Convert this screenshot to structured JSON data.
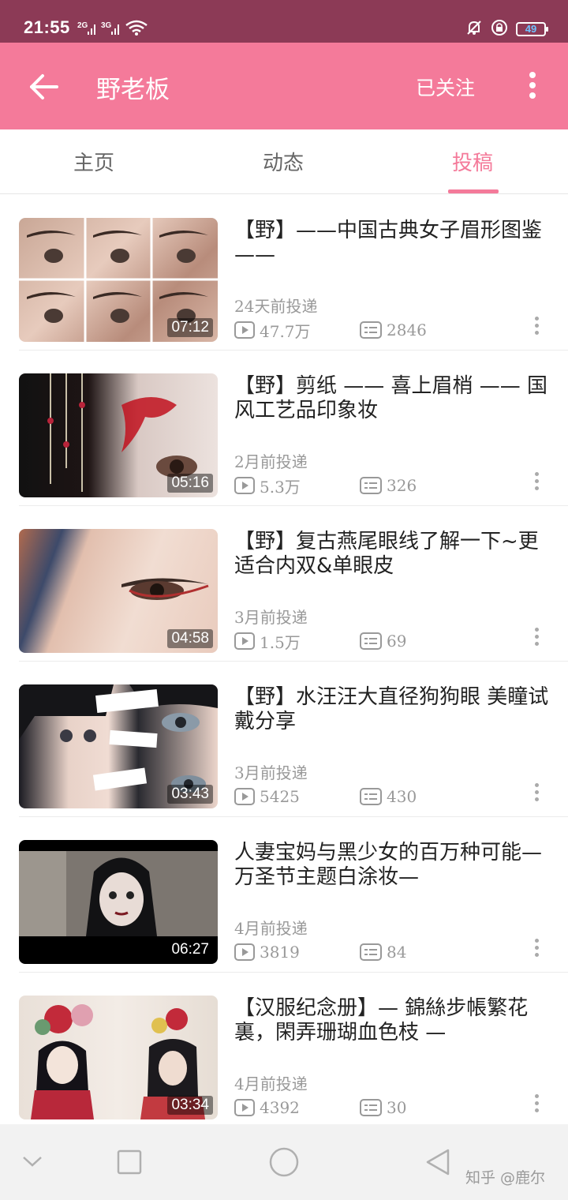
{
  "status_bar": {
    "time": "21:55",
    "signal_1": "2G",
    "signal_2": "3G",
    "battery": "49"
  },
  "app_bar": {
    "title": "野老板",
    "follow_label": "已关注",
    "background": "#f47a9a"
  },
  "tabs": [
    {
      "label": "主页",
      "active": false
    },
    {
      "label": "动态",
      "active": false
    },
    {
      "label": "投稿",
      "active": true
    }
  ],
  "videos": [
    {
      "title": "【野】——中国古典女子眉形图鉴——",
      "duration": "07:12",
      "posted": "24天前投递",
      "plays": "47.7万",
      "danmaku": "2846"
    },
    {
      "title": "【野】剪纸 —— 喜上眉梢 —— 国风工艺品印象妆",
      "duration": "05:16",
      "posted": "2月前投递",
      "plays": "5.3万",
      "danmaku": "326"
    },
    {
      "title": "【野】复古燕尾眼线了解一下~更适合内双&单眼皮",
      "duration": "04:58",
      "posted": "3月前投递",
      "plays": "1.5万",
      "danmaku": "69"
    },
    {
      "title": "【野】水汪汪大直径狗狗眼 美瞳试戴分享",
      "duration": "03:43",
      "posted": "3月前投递",
      "plays": "5425",
      "danmaku": "430"
    },
    {
      "title": "人妻宝妈与黑少女的百万种可能—万圣节主题白涂妆—",
      "duration": "06:27",
      "posted": "4月前投递",
      "plays": "3819",
      "danmaku": "84"
    },
    {
      "title": "【汉服纪念册】— 錦絲步帳繁花裏，閑弄珊瑚血色枝 —",
      "duration": "03:34",
      "posted": "4月前投递",
      "plays": "4392",
      "danmaku": "30"
    }
  ],
  "watermark": "知乎 @鹿尔"
}
